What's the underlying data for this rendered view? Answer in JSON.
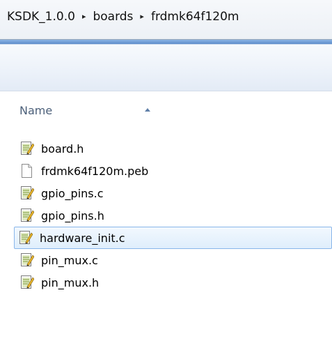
{
  "breadcrumb": {
    "items": [
      "KSDK_1.0.0",
      "boards",
      "frdmk64f120m"
    ],
    "separator_glyph": "▸"
  },
  "column_header": {
    "name_label": "Name"
  },
  "files": [
    {
      "name": "board.h",
      "icon": "text-edit-file-icon",
      "selected": false
    },
    {
      "name": "frdmk64f120m.peb",
      "icon": "blank-file-icon",
      "selected": false
    },
    {
      "name": "gpio_pins.c",
      "icon": "text-edit-file-icon",
      "selected": false
    },
    {
      "name": "gpio_pins.h",
      "icon": "text-edit-file-icon",
      "selected": false
    },
    {
      "name": "hardware_init.c",
      "icon": "text-edit-file-icon",
      "selected": true
    },
    {
      "name": "pin_mux.c",
      "icon": "text-edit-file-icon",
      "selected": false
    },
    {
      "name": "pin_mux.h",
      "icon": "text-edit-file-icon",
      "selected": false
    }
  ],
  "colors": {
    "selection_border": "#89b6ea",
    "selection_fill": "#dfeefc",
    "header_text": "#4c607a"
  }
}
